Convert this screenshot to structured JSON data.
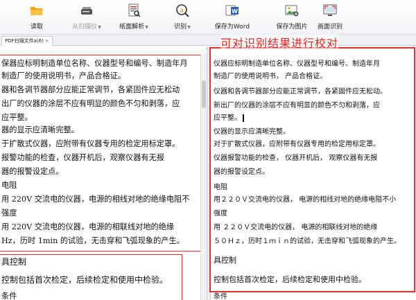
{
  "toolbar": {
    "items": [
      {
        "label": "读取",
        "icon": "folder-open-icon",
        "enabled": true
      },
      {
        "label": "从扫描仪",
        "icon": "scanner-icon",
        "enabled": false,
        "has_dropdown": true
      },
      {
        "label": "纸面解析",
        "icon": "page-analysis-icon",
        "enabled": true,
        "has_dropdown": true
      },
      {
        "label": "识别",
        "icon": "recognize-icon",
        "enabled": true,
        "has_dropdown": true
      },
      {
        "label": "保存为Word",
        "icon": "save-word-icon",
        "enabled": true
      },
      {
        "label": "保存为图片",
        "icon": "save-image-icon",
        "enabled": true
      },
      {
        "label": "画面识别",
        "icon": "screen-capture-icon",
        "enabled": true
      }
    ]
  },
  "tabs": [
    {
      "label": "PDF扫描文件a(6)",
      "close": "×"
    }
  ],
  "annotation": "可对识别结果进行校对",
  "colors": {
    "accent_red": "#e03030",
    "toolbar_bg": "#f1f3f6"
  },
  "scan_text": [
    "保器应标明制造单位名称、仪器型号和编号、制造年月",
    "制造厂的使用说明书，产品合格证。",
    "器和各调节器部分应能正常调节，各紧固件应无松动",
    "出厂的仪器的涂层不应有明显的颜色不匀和剥落，应",
    "应平整。",
    "器的显示应清晰完整。",
    "于扩散式仪器，应附带有仪器专用的检定用标定罩。",
    "报警功能的检查，仪器开机后，观察仪器有无报",
    "器的报警设定点。",
    "电阻",
    "用 220V 交流电的仪器，电源的相线对地的绝缘电阻不",
    "强度",
    "用 220V 交流电的仪器，电源的相联线对地的绝缘",
    "Hz，历时 1min 的试验，无击穿和飞弧现象的产生。",
    "",
    "具控制",
    "控制包括首次检定，后续检定和使用中检验。",
    "条件"
  ],
  "ocr_text": [
    "仪器应标明制造单位名称、仪器型号和编号、制造年月",
    "制造厂的使用说明书，  产品合格证。",
    "仪器和各调节器部分应能正常调节，各紧固件应无松动。",
    "  新出厂的仪器的涂层不应有明显的颜色不匀和剥落，应",
    "应平整。",
    "仪器的显示应清晰完整。",
    "对于扩散式仪器，应附带有仪器专用的检定用标定罩。",
    "  仪器报警功能的检查，  仪器开机后，  观察仪器有无报",
    "器的报警设定点。",
    "电阻",
    "用２２０Ｖ交流电的仪器，  电源的相线对地的绝缘电阻不小",
    "强度",
    "用  ２２０Ｖ交流电的仪器，  电源的相联线对地的绝缘",
    "５０Ｈｚ，历时１ｍｉｎ的试验，无击穿和飞弧现象的产生。",
    "",
    "具控制",
    "控制包括首次检定，后续检定和使用中检验。",
    "条件"
  ]
}
